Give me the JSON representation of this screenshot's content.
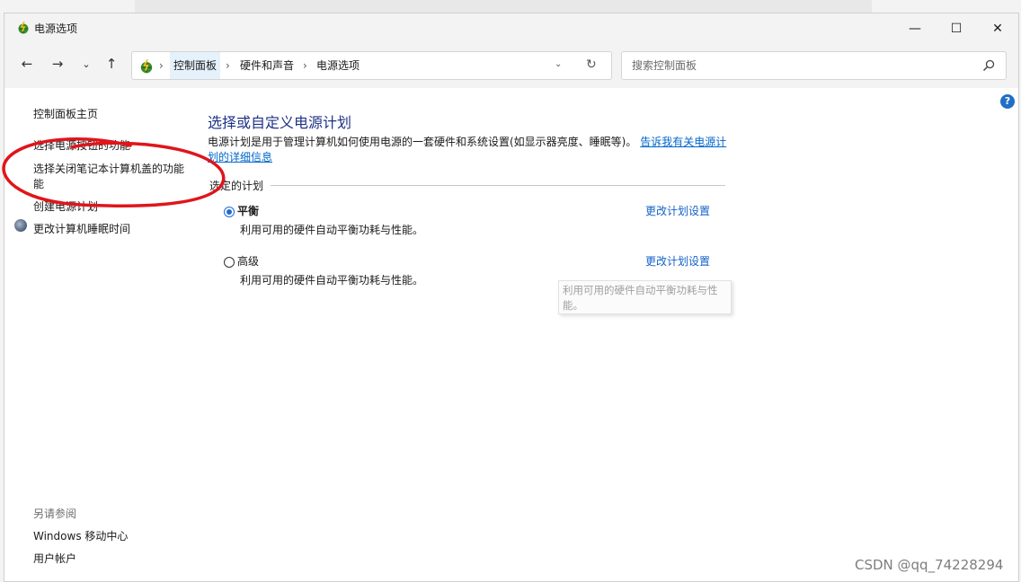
{
  "window": {
    "title": "电源选项",
    "icon": "power-options-icon",
    "controls": {
      "minimize": "—",
      "maximize": "☐",
      "close": "✕"
    }
  },
  "nav": {
    "back": "←",
    "forward": "→",
    "recent": "⌄",
    "up": "↑",
    "breadcrumb": [
      "控制面板",
      "硬件和声音",
      "电源选项"
    ],
    "separator": "›",
    "dropdown": "⌄",
    "refresh": "↻"
  },
  "search": {
    "placeholder": "搜索控制面板",
    "value": ""
  },
  "sidebar": {
    "links": [
      "控制面板主页",
      "选择电源按钮的功能",
      "选择关闭笔记本计算机盖的功能",
      "能",
      "创建电源计划",
      "更改计算机睡眠时间"
    ],
    "see_also_heading": "另请参阅",
    "see_also": [
      "Windows 移动中心",
      "用户帐户"
    ]
  },
  "main": {
    "title": "选择或自定义电源计划",
    "description": "电源计划是用于管理计算机如何使用电源的一套硬件和系统设置(如显示器亮度、睡眠等)。",
    "description_link_line1": "告诉我有关电源计",
    "description_link_line2": "划的详细信息",
    "group_label": "选定的计划",
    "plans": [
      {
        "name": "平衡",
        "selected": true,
        "desc": "利用可用的硬件自动平衡功耗与性能。",
        "link": "更改计划设置"
      },
      {
        "name": "高级",
        "selected": false,
        "desc": "利用可用的硬件自动平衡功耗与性能。",
        "link": "更改计划设置"
      }
    ],
    "tooltip": "利用可用的硬件自动平衡功耗与性能。"
  },
  "help": "?",
  "watermark": "CSDN @qq_74228294",
  "colors": {
    "title_blue": "#1e3287",
    "link_blue": "#1463c9",
    "annotation_red": "#e0151b",
    "radio_blue": "#1e6ad4"
  }
}
